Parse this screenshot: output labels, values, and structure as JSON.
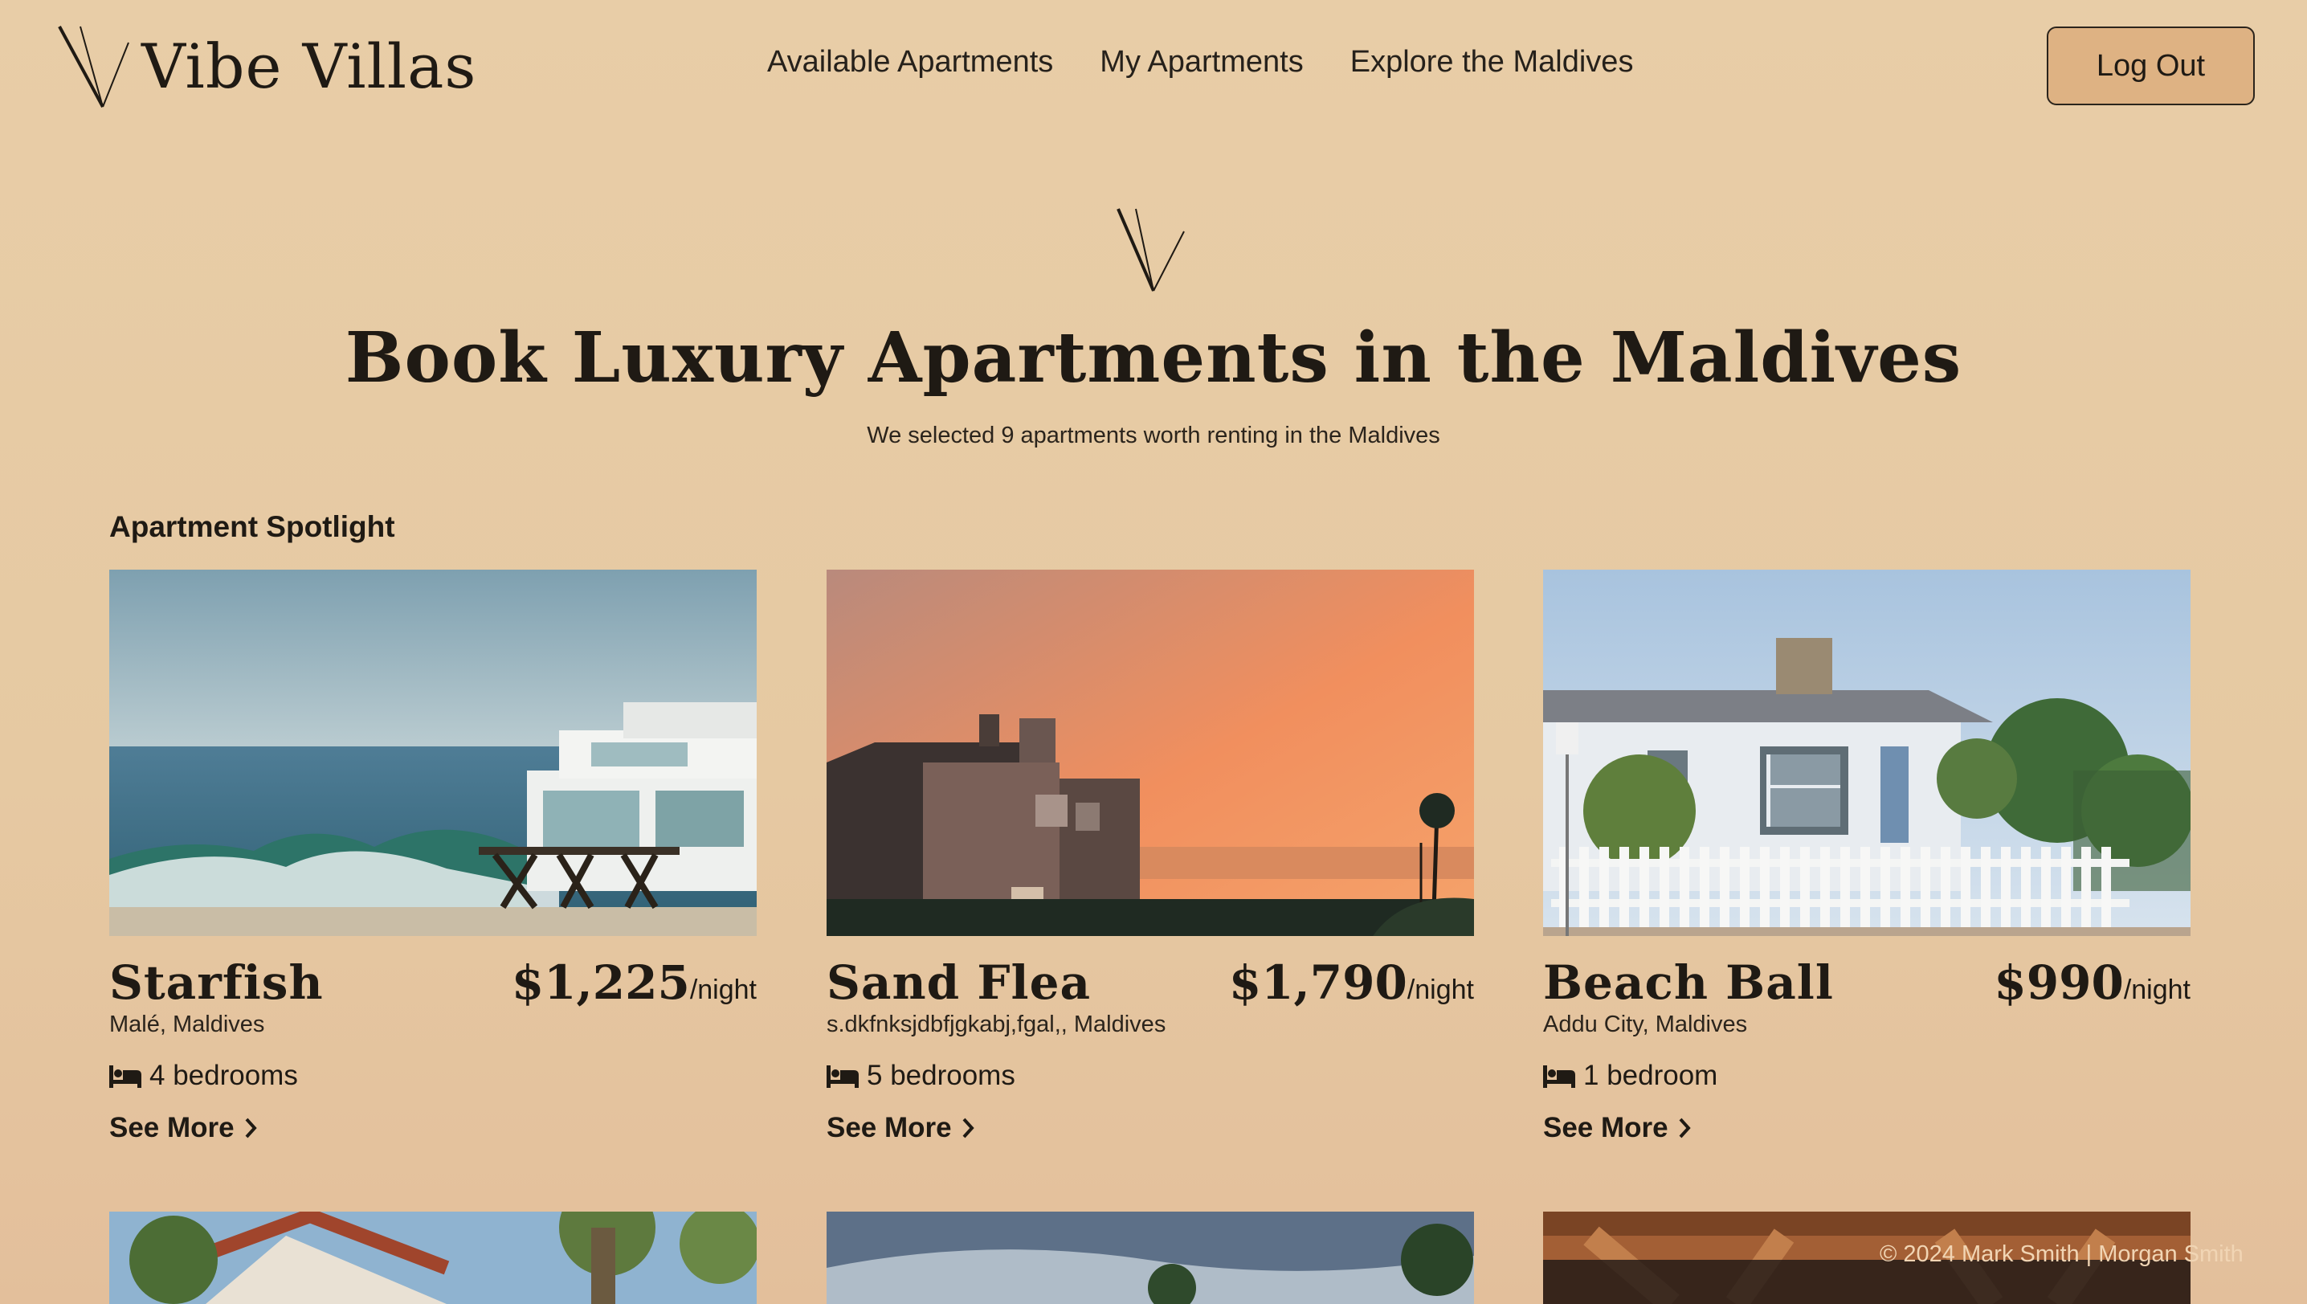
{
  "header": {
    "brand": "Vibe Villas",
    "nav": [
      "Available Apartments",
      "My Apartments",
      "Explore the Maldives"
    ],
    "logout_label": "Log Out"
  },
  "hero": {
    "title": "Book Luxury Apartments in the Maldives",
    "subtitle": "We selected 9 apartments worth renting in the Maldives"
  },
  "spotlight": {
    "title": "Apartment Spotlight",
    "see_more_label": "See More",
    "cards": [
      {
        "name": "Starfish",
        "price": "$1,225",
        "unit": "/night",
        "location": "Malé, Maldives",
        "bedrooms": "4 bedrooms",
        "photo": "beachfront modern house over crashing waves"
      },
      {
        "name": "Sand Flea",
        "price": "$1,790",
        "unit": "/night",
        "location": "s.dkfnksjdbfjgkabj,fgal,, Maldives",
        "bedrooms": "5 bedrooms",
        "photo": "houses silhouetted against orange sunset over sea"
      },
      {
        "name": "Beach Ball",
        "price": "$990",
        "unit": "/night",
        "location": "Addu City, Maldives",
        "bedrooms": "1 bedroom",
        "photo": "white cottage with picket fence and trees"
      }
    ]
  },
  "footer": {
    "text": "© 2024 Mark Smith | Morgan Smith"
  },
  "colors": {
    "background": "#e8cda7",
    "button": "#deb283",
    "text": "#1f1a14"
  },
  "icons": [
    "bed-icon",
    "chevron-right-icon",
    "vv-logo-icon"
  ]
}
